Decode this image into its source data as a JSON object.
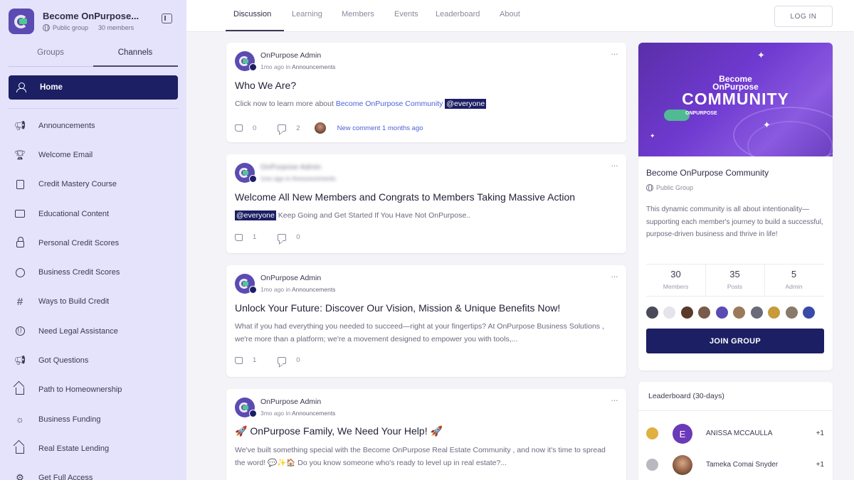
{
  "group": {
    "name": "Become OnPurpose...",
    "privacy": "Public group",
    "members": "30 members"
  },
  "sidebar": {
    "tabs": [
      "Groups",
      "Channels"
    ],
    "home": "Home",
    "items": [
      {
        "label": "Announcements",
        "icon": "megaphone-icon"
      },
      {
        "label": "Welcome Email",
        "icon": "trophy-icon"
      },
      {
        "label": "Credit Mastery Course",
        "icon": "document-icon"
      },
      {
        "label": "Educational Content",
        "icon": "briefcase-icon"
      },
      {
        "label": "Personal Credit Scores",
        "icon": "lock-icon"
      },
      {
        "label": "Business Credit Scores",
        "icon": "compass-icon"
      },
      {
        "label": "Ways to Build Credit",
        "icon": "hashtag-icon"
      },
      {
        "label": "Need Legal Assistance",
        "icon": "globe-icon"
      },
      {
        "label": "Got Questions",
        "icon": "megaphone-icon"
      },
      {
        "label": "Path to Homeownership",
        "icon": "house-icon"
      },
      {
        "label": "Business Funding",
        "icon": "lightbulb-icon"
      },
      {
        "label": "Real Estate Lending",
        "icon": "bank-icon"
      },
      {
        "label": "Get Full Access",
        "icon": "gear-icon"
      }
    ]
  },
  "topnav": {
    "tabs": [
      "Discussion",
      "Learning",
      "Members",
      "Events",
      "Leaderboard",
      "About"
    ],
    "login": "LOG IN"
  },
  "posts": [
    {
      "author": "OnPurpose Admin",
      "time": "1mo ago",
      "in": "in",
      "channel": "Announcements",
      "title": "Who We Are?",
      "body_pre": "Click now to learn more about ",
      "link": "Become OnPurpose Community",
      "mention": "@everyone",
      "likes": "0",
      "comments": "2",
      "new_comment": "New comment 1 months ago"
    },
    {
      "author": "OnPurpose Admin",
      "time": "1mo ago",
      "in": "in",
      "channel": "Announcements",
      "title": "Welcome All New Members and Congrats to Members Taking Massive Action",
      "mention": "@everyone",
      "body": " Keep Going and Get Started If You Have Not OnPurpose..",
      "likes": "1",
      "comments": "0"
    },
    {
      "author": "OnPurpose Admin",
      "time": "1mo ago",
      "in": "in",
      "channel": "Announcements",
      "title": "Unlock Your Future: Discover Our Vision, Mission & Unique Benefits Now!",
      "body": "What if you had everything you needed to succeed—right at your fingertips? At OnPurpose Business Solutions , we're more than a platform; we're a movement designed to empower you with tools,...",
      "likes": "1",
      "comments": "0"
    },
    {
      "author": "OnPurpose Admin",
      "time": "3mo ago",
      "in": "in",
      "channel": "Announcements",
      "title": "🚀 OnPurpose Family, We Need Your Help! 🚀",
      "body": "We've built something special with the Become OnPurpose Real Estate Community , and now it's time to spread the word! 💬✨🏠 Do you know someone who's ready to level up in real estate?..."
    }
  ],
  "about": {
    "banner_sub1": "Become",
    "banner_sub2": "OnPurpose",
    "banner_title": "COMMUNITY",
    "banner_logo": "ONPURPOSE",
    "name": "Become OnPurpose Community",
    "privacy": "Public Group",
    "description": "This dynamic community is all about intentionality—supporting each member's journey to build a successful, purpose-driven business and thrive in life!",
    "stats": [
      {
        "value": "30",
        "label": "Members"
      },
      {
        "value": "35",
        "label": "Posts"
      },
      {
        "value": "5",
        "label": "Admin"
      }
    ],
    "join": "JOIN GROUP"
  },
  "leaderboard": {
    "title": "Leaderboard (30-days)",
    "rows": [
      {
        "name": "ANISSA MCCAULLA",
        "initial": "E",
        "points": "+1"
      },
      {
        "name": "Tameka Comai Snyder",
        "initial": "",
        "points": "+1"
      }
    ]
  },
  "colors": {
    "accent": "#1c1f63",
    "sidebar_bg": "#e4e3fb",
    "brand_purple": "#5b4bb3",
    "link": "#4b62d8"
  }
}
